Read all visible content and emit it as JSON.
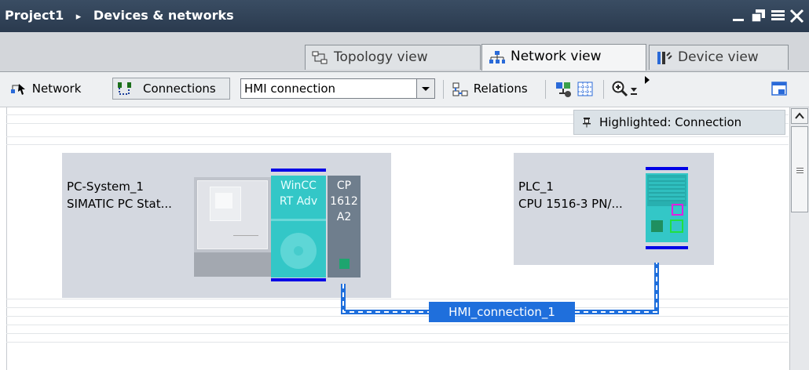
{
  "title_bar": {
    "breadcrumb": [
      "Project1",
      "Devices & networks"
    ],
    "separator": "▸"
  },
  "tabs": [
    {
      "label": "Topology view",
      "icon": "topology-icon",
      "active": false
    },
    {
      "label": "Network view",
      "icon": "network-icon",
      "active": true
    },
    {
      "label": "Device view",
      "icon": "device-icon",
      "active": false
    }
  ],
  "toolbar": {
    "network_label": "Network",
    "connections_label": "Connections",
    "connection_type": "HMI connection",
    "relations_label": "Relations"
  },
  "tooltip": {
    "text": "Highlighted: Connection"
  },
  "devices": [
    {
      "name": "PC-System_1",
      "type": "SIMATIC PC Stat...",
      "modules": [
        {
          "lines": [
            "WinCC",
            "RT Adv"
          ]
        },
        {
          "lines": [
            "CP",
            "1612",
            "A2"
          ]
        }
      ]
    },
    {
      "name": "PLC_1",
      "type": "CPU 1516-3 PN/..."
    }
  ],
  "connection": {
    "label": "HMI_connection_1"
  },
  "colors": {
    "title_bar": "#2f4157",
    "device_bg": "#d4d8e0",
    "module_teal": "#33c7c7",
    "connection_blue": "#1f6fdc",
    "subnet_blue": "#0000e6"
  }
}
